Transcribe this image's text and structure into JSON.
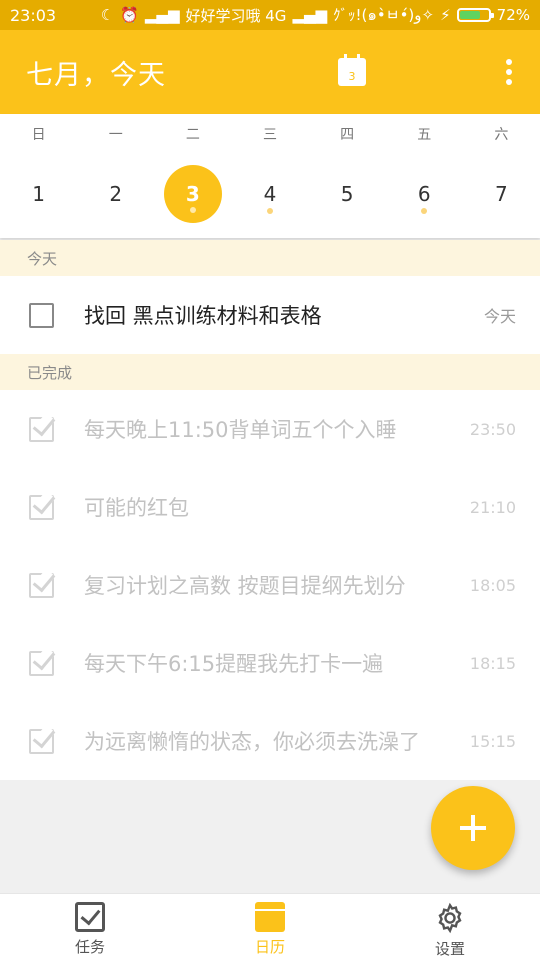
{
  "status_bar": {
    "time": "23:03",
    "carrier_text": "好好学习哦 4G",
    "extra_text": "ｸﾞｯ!(๑•̀ㅂ•́)و✧",
    "battery": "72%",
    "battery_level": 0.72
  },
  "header": {
    "title": "七月，今天",
    "calendar_day": "3"
  },
  "week": {
    "weekdays": [
      "日",
      "一",
      "二",
      "三",
      "四",
      "五",
      "六"
    ],
    "dates": [
      "1",
      "2",
      "3",
      "4",
      "5",
      "6",
      "7"
    ],
    "selected_index": 2,
    "dot_indices": [
      2,
      3,
      5
    ]
  },
  "sections": {
    "today": "今天",
    "completed": "已完成"
  },
  "today_tasks": [
    {
      "title": "找回 黑点训练材料和表格",
      "time": "今天"
    }
  ],
  "completed_tasks": [
    {
      "title": "每天晚上11:50背单词五个个入睡",
      "time": "23:50"
    },
    {
      "title": "可能的红包",
      "time": "21:10"
    },
    {
      "title": "复习计划之高数  按题目提纲先划分",
      "time": "18:05"
    },
    {
      "title": "每天下午6:15提醒我先打卡一遍",
      "time": "18:15"
    },
    {
      "title": "为远离懒惰的状态，你必须去洗澡了",
      "time": "15:15"
    }
  ],
  "bottom_nav": {
    "tasks": "任务",
    "calendar": "日历",
    "settings": "设置"
  },
  "colors": {
    "accent": "#fbc21a",
    "status_bar": "#e5ac00",
    "section_bg": "#fdf5de"
  }
}
